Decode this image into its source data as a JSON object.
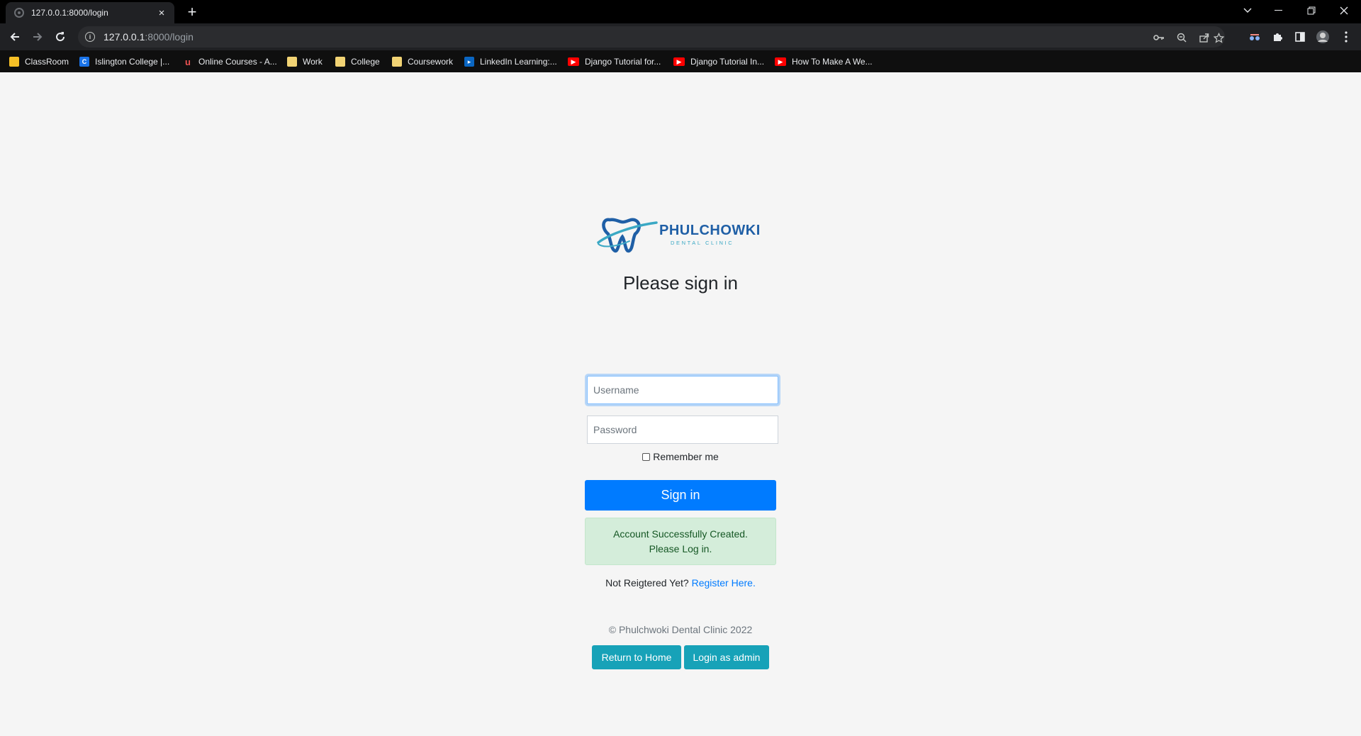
{
  "browser": {
    "tab_title": "127.0.0.1:8000/login",
    "tab_close": "×",
    "new_tab": "+",
    "url_host": "127.0.0.1",
    "url_rest": ":8000/login",
    "bookmarks": [
      {
        "label": "ClassRoom",
        "icon": "classroom-icon"
      },
      {
        "label": "Islington College |...",
        "icon": "islington-icon"
      },
      {
        "label": "Online Courses - A...",
        "icon": "udemy-icon"
      },
      {
        "label": "Work",
        "icon": "folder-icon"
      },
      {
        "label": "College",
        "icon": "folder-icon"
      },
      {
        "label": "Coursework",
        "icon": "folder-icon"
      },
      {
        "label": "LinkedIn Learning:...",
        "icon": "linkedin-icon"
      },
      {
        "label": "Django Tutorial for...",
        "icon": "youtube-icon"
      },
      {
        "label": "Django Tutorial In...",
        "icon": "youtube-icon"
      },
      {
        "label": "How To Make A We...",
        "icon": "youtube-icon"
      }
    ]
  },
  "logo": {
    "name": "PHULCHOWKI",
    "subtitle": "DENTAL CLINIC"
  },
  "login": {
    "heading": "Please sign in",
    "username_placeholder": "Username",
    "password_placeholder": "Password",
    "remember_label": "Remember me",
    "signin_label": "Sign in",
    "alert_line1": "Account Successfully Created.",
    "alert_line2": "Please Log in.",
    "register_prompt": "Not Reigtered Yet?",
    "register_link": "Register Here.",
    "copyright": "© Phulchwoki Dental Clinic 2022",
    "home_button": "Return to Home",
    "admin_button": "Login as admin"
  },
  "colors": {
    "primary": "#007bff",
    "info": "#17a2b8",
    "success_bg": "#d4edda",
    "success_text": "#155724",
    "logo_blue": "#1f5fa6",
    "logo_teal": "#3aa8c4"
  }
}
